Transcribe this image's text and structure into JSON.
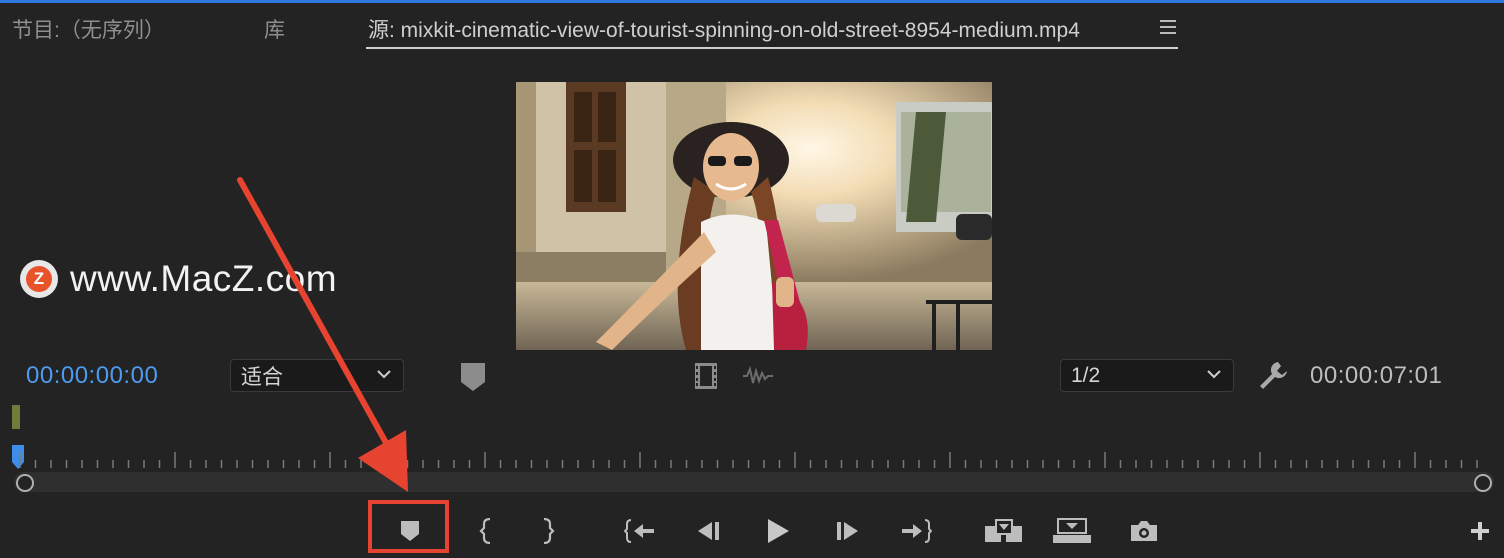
{
  "tabs": {
    "program": "节目:（无序列）",
    "library": "库",
    "source": "源: mixkit-cinematic-view-of-tourist-spinning-on-old-street-8954-medium.mp4"
  },
  "watermark": {
    "logo_letter": "Z",
    "text": "www.MacZ.com"
  },
  "monitor": {
    "timecode_current": "00:00:00:00",
    "timecode_duration": "00:00:07:01",
    "fit_label": "适合",
    "resolution_label": "1/2"
  },
  "colors": {
    "accent_blue": "#4d9bf0",
    "highlight_red": "#e64330",
    "background": "#232323"
  },
  "controls": [
    "add-marker-icon",
    "mark-in-icon",
    "mark-out-icon",
    "go-to-in-icon",
    "step-back-icon",
    "play-icon",
    "step-forward-icon",
    "go-to-out-icon",
    "insert-icon",
    "overwrite-icon",
    "export-frame-icon",
    "add-button-icon"
  ]
}
